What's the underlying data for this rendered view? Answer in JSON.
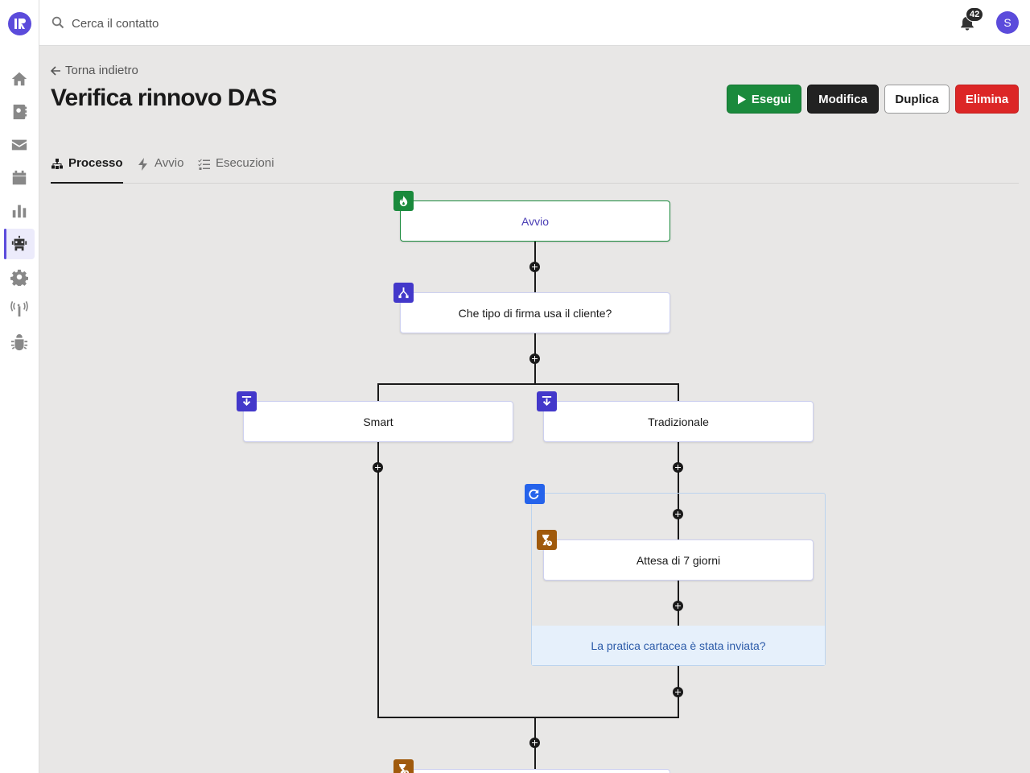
{
  "search": {
    "placeholder": "Cerca il contatto"
  },
  "notifications": {
    "count": "42"
  },
  "user": {
    "initial": "S"
  },
  "header": {
    "back_label": "Torna indietro",
    "title": "Verifica rinnovo DAS",
    "actions": {
      "run": "Esegui",
      "edit": "Modifica",
      "duplicate": "Duplica",
      "delete": "Elimina"
    }
  },
  "tabs": [
    {
      "label": "Processo",
      "icon": "sitemap-icon",
      "active": true
    },
    {
      "label": "Avvio",
      "icon": "bolt-icon",
      "active": false
    },
    {
      "label": "Esecuzioni",
      "icon": "list-check-icon",
      "active": false
    }
  ],
  "sidebar": {
    "items": [
      "home-icon",
      "contacts-icon",
      "mail-icon",
      "calendar-icon",
      "chart-icon",
      "robot-icon",
      "gear-icon",
      "antenna-icon",
      "bug-icon"
    ],
    "active": "robot-icon"
  },
  "flow": {
    "start": "Avvio",
    "branch": "Che tipo di firma usa il cliente?",
    "option_a": "Smart",
    "option_b": "Tradizionale",
    "wait": "Attesa di 7 giorni",
    "loop_condition": "La pratica cartacea è stata inviata?"
  },
  "colors": {
    "brand": "#5b4bdb",
    "run": "#1a8a3c",
    "delete": "#dc2626",
    "dark": "#222222",
    "wait": "#a05a0c",
    "loop": "#2563eb"
  }
}
